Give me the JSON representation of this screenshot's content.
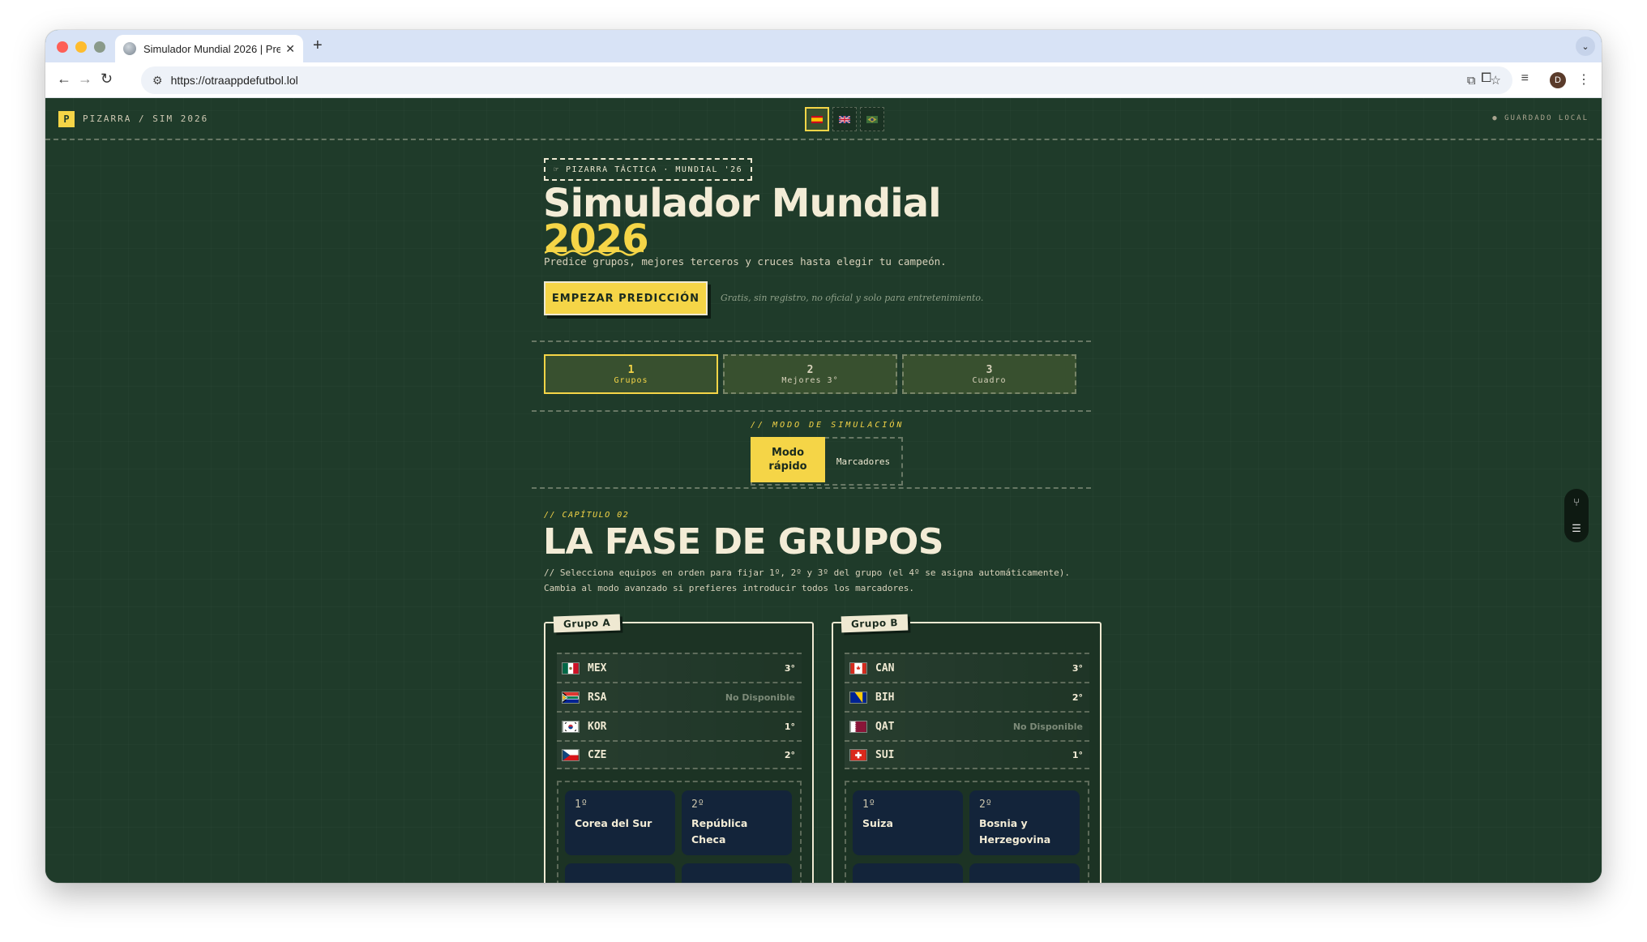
{
  "browser": {
    "tab_title": "Simulador Mundial 2026 | Pre",
    "url": "https://otraappdefutbol.lol",
    "profile_initial": "D"
  },
  "topbar": {
    "brand_logo": "P",
    "brand_text": "PIZARRA / SIM 2026",
    "languages": [
      "es",
      "en",
      "pt"
    ],
    "saved_label": "● GUARDADO LOCAL"
  },
  "hero": {
    "kicker": "☞ PIZARRA TÁCTICA · MUNDIAL '26",
    "title": "Simulador Mundial",
    "year": "2026",
    "subtitle": "Predice grupos, mejores terceros y cruces hasta elegir tu campeón.",
    "cta": "EMPEZAR PREDICCIÓN",
    "note": "Gratis, sin registro, no oficial y solo para entretenimiento."
  },
  "steps": [
    {
      "num": "1",
      "label": "Grupos"
    },
    {
      "num": "2",
      "label": "Mejores 3°"
    },
    {
      "num": "3",
      "label": "Cuadro"
    }
  ],
  "mode": {
    "label": "// MODO DE SIMULACIÓN",
    "quick_line1": "Modo",
    "quick_line2": "rápido",
    "scores": "Marcadores"
  },
  "section": {
    "chapter": "// CAPÍTULO 02",
    "title": "LA FASE DE GRUPOS",
    "desc": "// Selecciona equipos en orden para fijar 1º, 2º y 3º del grupo (el 4º se asigna automáticamente). Cambia al modo avanzado si prefieres introducir todos los marcadores."
  },
  "groups": [
    {
      "name": "Grupo A",
      "teams": [
        {
          "code": "MEX",
          "pos": "3°"
        },
        {
          "code": "RSA",
          "pos": "No Disponible"
        },
        {
          "code": "KOR",
          "pos": "1°"
        },
        {
          "code": "CZE",
          "pos": "2°"
        }
      ],
      "results": [
        {
          "rank": "1º",
          "name": "Corea del Sur"
        },
        {
          "rank": "2º",
          "name": "República Checa"
        }
      ]
    },
    {
      "name": "Grupo B",
      "teams": [
        {
          "code": "CAN",
          "pos": "3°"
        },
        {
          "code": "BIH",
          "pos": "2°"
        },
        {
          "code": "QAT",
          "pos": "No Disponible"
        },
        {
          "code": "SUI",
          "pos": "1°"
        }
      ],
      "results": [
        {
          "rank": "1º",
          "name": "Suiza"
        },
        {
          "rank": "2º",
          "name": "Bosnia y Herzegovina"
        }
      ]
    }
  ],
  "colors": {
    "background": "#1f3b2a",
    "accent": "#f5d547",
    "chalk": "#efe9d2",
    "result_card": "#13243a"
  }
}
